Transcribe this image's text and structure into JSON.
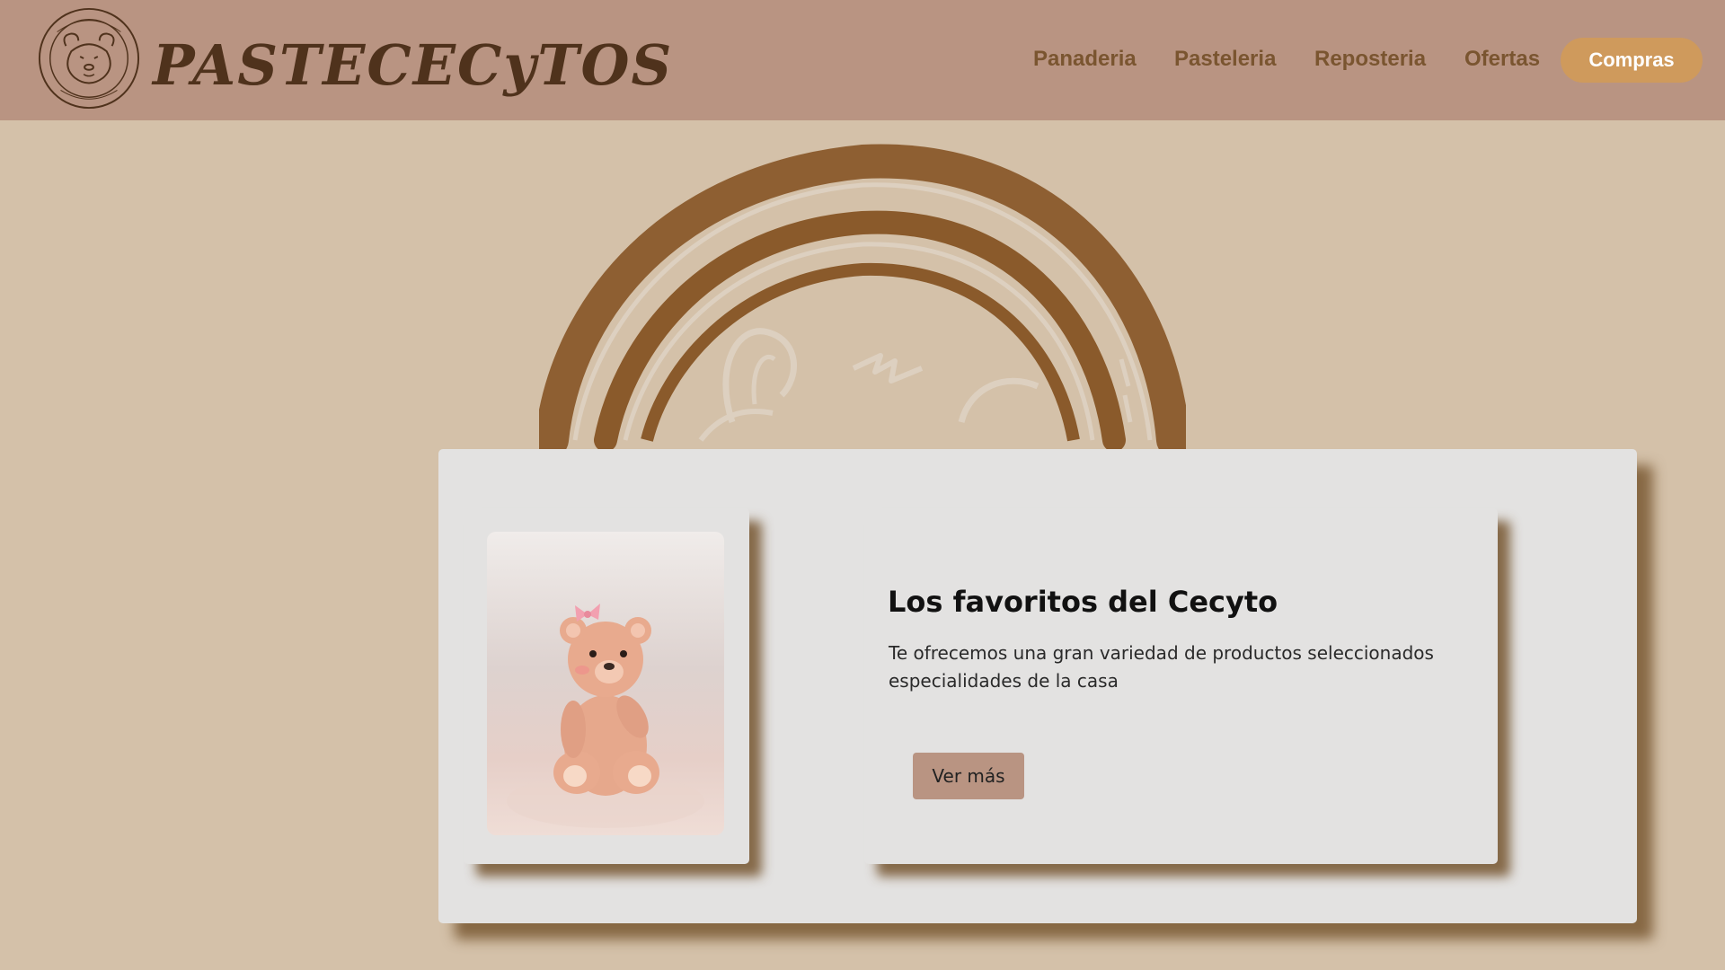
{
  "brand": {
    "name": "PASTECECyTOS",
    "emblem_icon": "bear-face-seal-icon",
    "emblem_text": "PASTECECyTOS"
  },
  "nav": {
    "links": [
      {
        "label": "Panaderia"
      },
      {
        "label": "Pasteleria"
      },
      {
        "label": "Reposteria"
      },
      {
        "label": "Ofertas"
      }
    ],
    "cta_label": "Compras"
  },
  "hero": {
    "emblem_icon": "bear-seal-watermark-icon"
  },
  "featured": {
    "title": "Los favoritos del Cecyto",
    "description": "Te ofrecemos una gran variedad de productos seleccionados especialidades de la casa",
    "button_label": "Ver más",
    "image_icon": "teddy-bear-fondant-photo"
  },
  "colors": {
    "navbar_bg": "#b99482",
    "page_bg": "#d4c1a9",
    "card_bg": "#e3e2e1",
    "accent_button": "#cf9a5c",
    "nav_link": "#7a5530",
    "brand_dark": "#4f321c",
    "watermark": "#8a5a2b"
  }
}
